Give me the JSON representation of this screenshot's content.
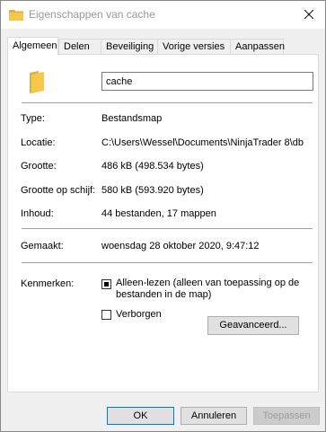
{
  "window": {
    "title": "Eigenschappen van cache"
  },
  "tabs": [
    {
      "label": "Algemeen"
    },
    {
      "label": "Delen"
    },
    {
      "label": "Beveiliging"
    },
    {
      "label": "Vorige versies"
    },
    {
      "label": "Aanpassen"
    }
  ],
  "general": {
    "name_value": "cache",
    "rows": {
      "type": {
        "label": "Type:",
        "value": "Bestandsmap"
      },
      "location": {
        "label": "Locatie:",
        "value": "C:\\Users\\Wessel\\Documents\\NinjaTrader 8\\db"
      },
      "size": {
        "label": "Grootte:",
        "value": "486 kB (498.534 bytes)"
      },
      "size_on_disk": {
        "label": "Grootte op schijf:",
        "value": "580 kB (593.920 bytes)"
      },
      "contents": {
        "label": "Inhoud:",
        "value": "44 bestanden, 17 mappen"
      },
      "created": {
        "label": "Gemaakt:",
        "value": "woensdag 28 oktober 2020, 9:47:12"
      }
    },
    "attributes": {
      "label": "Kenmerken:",
      "readonly_label": "Alleen-lezen (alleen van toepassing op de bestanden in de map)",
      "readonly_state": "indeterminate",
      "hidden_label": "Verborgen",
      "hidden_checked": false,
      "advanced_button": "Geavanceerd..."
    }
  },
  "footer": {
    "ok": "OK",
    "cancel": "Annuleren",
    "apply": "Toepassen"
  },
  "colors": {
    "folder": "#f5c84c",
    "accent": "#0078d7"
  }
}
